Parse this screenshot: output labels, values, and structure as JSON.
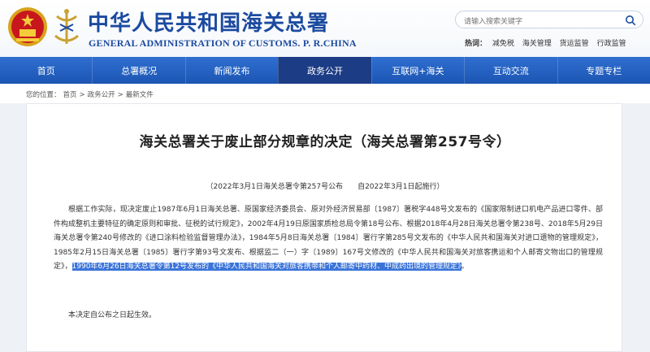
{
  "header": {
    "title": "中华人民共和国海关总署",
    "title_en": "GENERAL ADMINISTRATION OF CUSTOMS. P. R.CHINA",
    "search_placeholder": "请输入搜索关键字",
    "hot_label": "热词：",
    "hot_words": [
      "减免税",
      "海关管理",
      "货运监管",
      "行政监管"
    ]
  },
  "nav": {
    "items": [
      "首页",
      "总署概况",
      "新闻发布",
      "政务公开",
      "互联网+海关",
      "互动交流",
      "专题专栏"
    ],
    "active_index": 3
  },
  "breadcrumb": {
    "prefix": "您的位置：",
    "items": [
      "首页",
      "政务公开",
      "最新文件"
    ],
    "separator": ">"
  },
  "article": {
    "title": "海关总署关于废止部分规章的决定（海关总署第257号令）",
    "subtitle": "（2022年3月1日海关总署令第257号公布　　自2022年3月1日起施行）",
    "body_normal": "根据工作实际，现决定废止1987年6月1日海关总署、原国家经济委员会、原对外经济贸易部〔1987〕署税字448号文发布的《国家限制进口机电产品进口零件、部件构成整机主要特征的确定原则和审批、征税的试行规定》，2002年4月19日原国家质检总局令第18号公布、根据2018年4月28日海关总署令第238号、2018年5月29日海关总署令第240号修改的《进口涂料检验监督管理办法》，1984年5月8日海关总署〔1984〕署行字第285号文发布的《中华人民共和国海关对进口遗物的管理规定》，1985年2月15日海关总署〔1985〕署行字第93号文发布、根据监二（一）字〔1989〕167号文修改的《中华人民共和国海关对旅客携运和个人邮寄文物出口的管理规定》，",
    "body_highlight": "1990年6月26日海关总署令第12号发布的《中华人民共和国海关对旅客携带和个人邮寄中药材、中成药出境的管理规定》",
    "body_tail": "。",
    "closing": "本决定自公布之日起生效。"
  },
  "colors": {
    "brand_blue": "#1b4aa0",
    "nav_blue": "#2a63c3",
    "nav_active": "#1d3c86",
    "highlight": "#3a74d9"
  }
}
